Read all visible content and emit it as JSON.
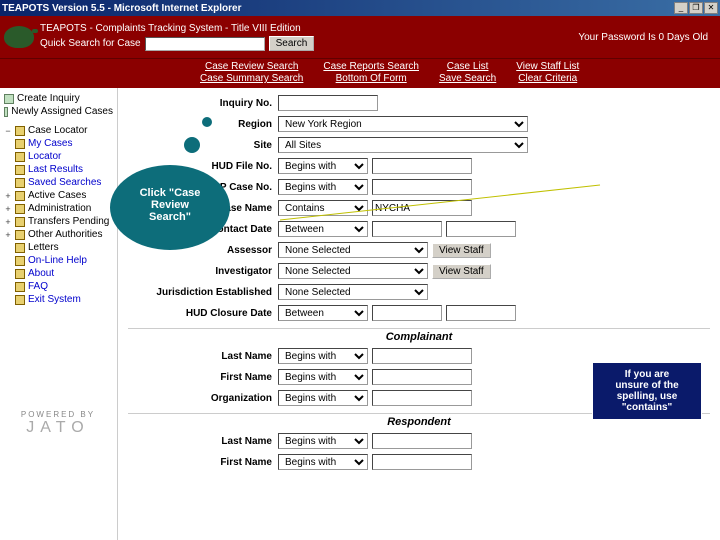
{
  "window": {
    "title": "TEAPOTS Version 5.5 - Microsoft Internet Explorer"
  },
  "header": {
    "banner": "TEAPOTS - Complaints Tracking System - Title VIII Edition",
    "quick_label": "Quick Search for Case",
    "search_btn": "Search",
    "pw_msg": "Your Password Is 0 Days Old"
  },
  "menu": {
    "c1a": "Case Review Search",
    "c1b": "Case Summary Search",
    "c2a": "Case Reports Search",
    "c2b": "Bottom Of Form",
    "c3a": "Case List",
    "c3b": "Save Search",
    "c4a": "View Staff List",
    "c4b": "Clear Criteria"
  },
  "sidebar": {
    "top": [
      {
        "label": "Create Inquiry"
      },
      {
        "label": "Newly Assigned Cases"
      }
    ],
    "tree": [
      {
        "exp": "−",
        "label": "Case Locator",
        "link": false
      },
      {
        "exp": "",
        "label": "My Cases",
        "link": true
      },
      {
        "exp": "",
        "label": "Locator",
        "link": true
      },
      {
        "exp": "",
        "label": "Last Results",
        "link": true
      },
      {
        "exp": "",
        "label": "Saved Searches",
        "link": true
      },
      {
        "exp": "+",
        "label": "Active Cases",
        "link": false
      },
      {
        "exp": "+",
        "label": "Administration",
        "link": false
      },
      {
        "exp": "+",
        "label": "Transfers Pending",
        "link": false
      },
      {
        "exp": "+",
        "label": "Other Authorities",
        "link": false
      },
      {
        "exp": "",
        "label": "Letters",
        "link": false
      },
      {
        "exp": "",
        "label": "On-Line Help",
        "link": true
      },
      {
        "exp": "",
        "label": "About",
        "link": true
      },
      {
        "exp": "",
        "label": "FAQ",
        "link": true
      },
      {
        "exp": "",
        "label": "Exit System",
        "link": true
      }
    ]
  },
  "opt": {
    "begins": "Begins with",
    "contains": "Contains",
    "between": "Between",
    "none": "None Selected",
    "region": "New York Region",
    "allsites": "All Sites"
  },
  "form": {
    "inquiry_lbl": "Inquiry No.",
    "region_lbl": "Region",
    "site_lbl": "Site",
    "hud_lbl": "HUD File No.",
    "fhap_lbl": "FHAP Case No.",
    "casename_lbl": "Case Name",
    "casename_val": "NYCHA",
    "contact_lbl": "Contact Date",
    "assessor_lbl": "Assessor",
    "viewstaff": "View Staff",
    "investigator_lbl": "Investigator",
    "juris_lbl": "Jurisdiction Established",
    "closure_lbl": "HUD Closure Date",
    "complainant_hdr": "Complainant",
    "respondent_hdr": "Respondent",
    "last_lbl": "Last Name",
    "first_lbl": "First Name",
    "org_lbl": "Organization"
  },
  "bubble": {
    "l1": "Click \"Case",
    "l2": "Review",
    "l3": "Search\""
  },
  "tip": {
    "l1": "If you are",
    "l2": "unsure of the",
    "l3": "spelling, use",
    "l4": "\"contains\""
  },
  "jato": {
    "small": "POWERED BY",
    "big": "JATO"
  }
}
